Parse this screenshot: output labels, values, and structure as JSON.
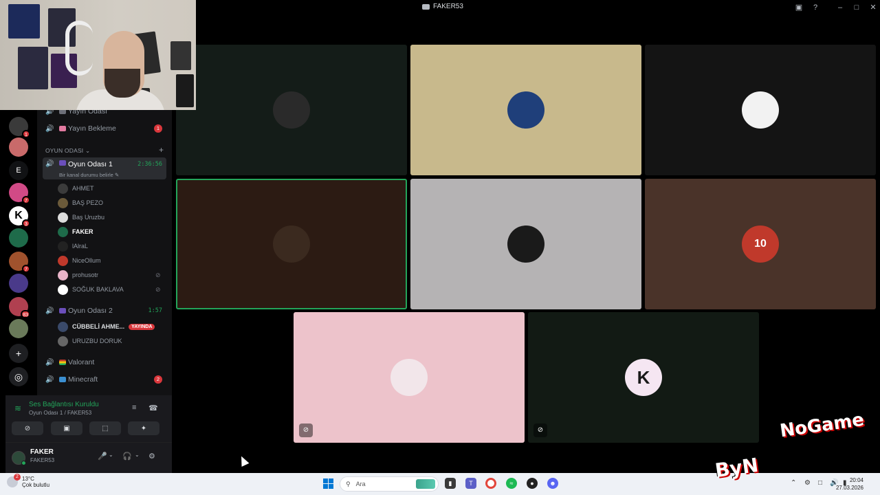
{
  "window": {
    "title": "FAKER53"
  },
  "rail": {
    "servers": [
      {
        "name": "server-1",
        "badge": "1",
        "color": "#3a3a3a"
      },
      {
        "name": "server-2",
        "badge": "",
        "color": "#c96a6a"
      },
      {
        "name": "server-e",
        "label": "E",
        "badge": "",
        "color": "#111214"
      },
      {
        "name": "server-4",
        "badge": "7",
        "color": "#d14a86"
      },
      {
        "name": "server-k",
        "label": "K",
        "badge": "3",
        "color": "#ffffff"
      },
      {
        "name": "server-6",
        "badge": "",
        "color": "#1e6b4a"
      },
      {
        "name": "server-7",
        "badge": "7",
        "color": "#a0522d"
      },
      {
        "name": "server-8",
        "badge": "",
        "color": "#4a3a8a"
      },
      {
        "name": "server-9",
        "badge": "83",
        "color": "#b04050"
      },
      {
        "name": "server-10",
        "badge": "",
        "color": "#6a7a5a"
      }
    ],
    "add_label": "+",
    "explore_label": "◎"
  },
  "channels": {
    "top_channels": [
      {
        "label": "Yayın Odası"
      },
      {
        "label": "Yayın Bekleme",
        "count": "1"
      }
    ],
    "category": "OYUN ODASI",
    "active_channel": {
      "label": "Oyun Odası 1",
      "timer": "2:36:56",
      "status": "Bir kanal durumu belirle"
    },
    "members": [
      {
        "name": "AHMET",
        "color": "#3b3b3b"
      },
      {
        "name": "BAŞ PEZO",
        "color": "#6b5a3a"
      },
      {
        "name": "Baş Uruzbu",
        "color": "#ddd"
      },
      {
        "name": "FAKER",
        "color": "#1e6b4a",
        "me": true
      },
      {
        "name": "lAlraL",
        "color": "#222"
      },
      {
        "name": "NiceOllum",
        "color": "#c0392b"
      },
      {
        "name": "prohusotr",
        "color": "#e8b4c8",
        "muted": true
      },
      {
        "name": "SOĞUK BAKLAVA",
        "color": "#fff",
        "muted": true
      }
    ],
    "second_channel": {
      "label": "Oyun Odası 2",
      "timer": "1:57"
    },
    "second_members": [
      {
        "name": "CÜBBELİ AHME...",
        "color": "#3a4a6a",
        "live": "YAYINDA"
      },
      {
        "name": "URUZBU DORUK",
        "color": "#666"
      }
    ],
    "other_channels": [
      {
        "label": "Valorant"
      },
      {
        "label": "Minecraft",
        "count": "2"
      }
    ]
  },
  "voice_panel": {
    "status": "Ses Bağlantısı Kuruldu",
    "location": "Oyun Odası 1 / FAKER53",
    "buttons": [
      "⊘",
      "▣",
      "⬚",
      "✦"
    ]
  },
  "user": {
    "name": "FAKER",
    "tag": "FAKER53"
  },
  "tiles": [
    {
      "name": "tile-ghostface",
      "bg": "#141c18",
      "avatar_bg": "#2a2a2a"
    },
    {
      "name": "tile-fenerbahce",
      "bg": "#c8b98c",
      "avatar_bg": "#1f3f7a"
    },
    {
      "name": "tile-anime-red",
      "bg": "#141414",
      "avatar_bg": "#f2f2f2"
    },
    {
      "name": "tile-dark-brown",
      "bg": "#2c1b13",
      "avatar_bg": "#3b2a1f",
      "speaking": true
    },
    {
      "name": "tile-cat-ears",
      "bg": "#b5b3b4",
      "avatar_bg": "#1a1a1a"
    },
    {
      "name": "tile-galatasaray",
      "bg": "#4a3329",
      "avatar_bg": "#c0392b",
      "avatar_label": "10"
    },
    {
      "name": "tile-pink",
      "bg": "#edc3cb",
      "avatar_bg": "#f2e6ea",
      "muted": true
    },
    {
      "name": "tile-k-logo",
      "bg": "#121a14",
      "avatar_bg": "#f5e6f2",
      "avatar_label": "K",
      "muted": true
    }
  ],
  "watermark": {
    "top": "NoGame",
    "bottom": "ByN"
  },
  "taskbar": {
    "weather_badge": "2",
    "temp": "13°C",
    "weather": "Çok bulutlu",
    "search_placeholder": "Ara",
    "time": "20:04",
    "date": "27.03.2026"
  }
}
